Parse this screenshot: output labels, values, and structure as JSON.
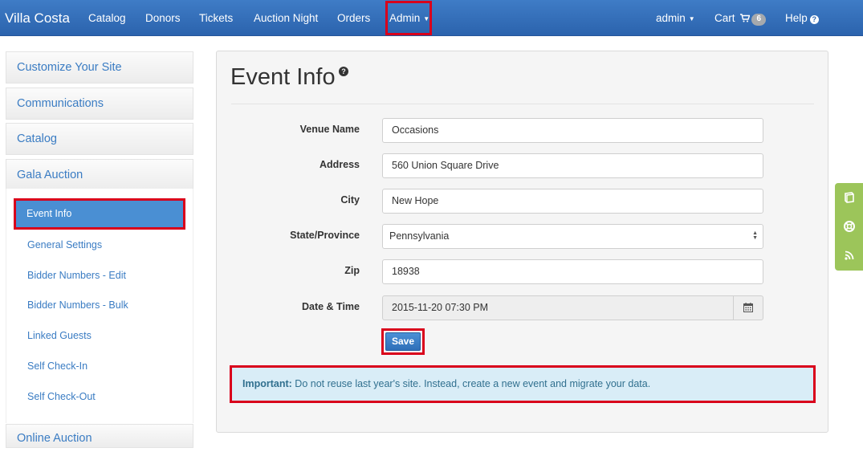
{
  "navbar": {
    "brand": "Villa Costa",
    "items": [
      "Catalog",
      "Donors",
      "Tickets",
      "Auction Night",
      "Orders"
    ],
    "admin_label": "Admin",
    "user_label": "admin",
    "cart_label": "Cart",
    "cart_count": "6",
    "help_label": "Help"
  },
  "sidebar": {
    "sections": [
      "Customize Your Site",
      "Communications",
      "Catalog",
      "Gala Auction"
    ],
    "active_item": "Event Info",
    "items": [
      "General Settings",
      "Bidder Numbers - Edit",
      "Bidder Numbers - Bulk",
      "Linked Guests",
      "Self Check-In",
      "Self Check-Out"
    ],
    "bottom_section": "Online Auction"
  },
  "main": {
    "title": "Event Info",
    "fields": {
      "venue_label": "Venue Name",
      "venue_value": "Occasions",
      "address_label": "Address",
      "address_value": "560 Union Square Drive",
      "city_label": "City",
      "city_value": "New Hope",
      "state_label": "State/Province",
      "state_value": "Pennsylvania",
      "zip_label": "Zip",
      "zip_value": "18938",
      "datetime_label": "Date & Time",
      "datetime_value": "2015-11-20 07:30 PM"
    },
    "save_label": "Save",
    "alert_strong": "Important:",
    "alert_text": " Do not reuse last year's site. Instead, create a new event and migrate your data."
  },
  "colors": {
    "navbar": "#2e67b1",
    "link": "#3a7cc3",
    "active": "#4a8fd3",
    "highlight": "#d9001b",
    "alert_bg": "#d9edf7",
    "tool_tab": "#9cc55a"
  },
  "tool_icons": [
    "book-icon",
    "lifebuoy-icon",
    "rss-icon"
  ]
}
